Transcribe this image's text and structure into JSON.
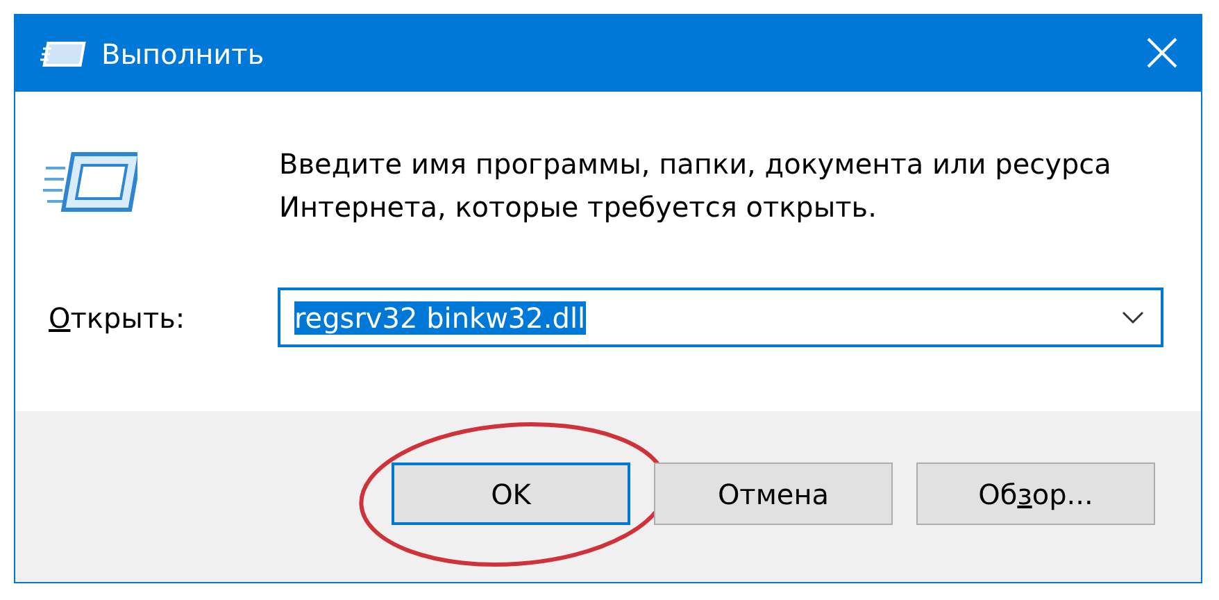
{
  "window": {
    "title": "Выполнить"
  },
  "prompt": "Введите имя программы, папки, документа или ресурса Интернета, которые требуется открыть.",
  "open_field": {
    "label": {
      "access_key": "О",
      "after": "ткрыть:"
    },
    "value": "regsrv32 binkw32.dll",
    "text_selected": true,
    "focused": true
  },
  "buttons": [
    {
      "label": {
        "before": "OK"
      },
      "default": true,
      "circled": true
    },
    {
      "label": {
        "before": "Отмена"
      },
      "default": false,
      "circled": false
    },
    {
      "label": {
        "before": "Об",
        "access_key": "з",
        "after": "ор..."
      },
      "default": false,
      "circled": false
    }
  ]
}
